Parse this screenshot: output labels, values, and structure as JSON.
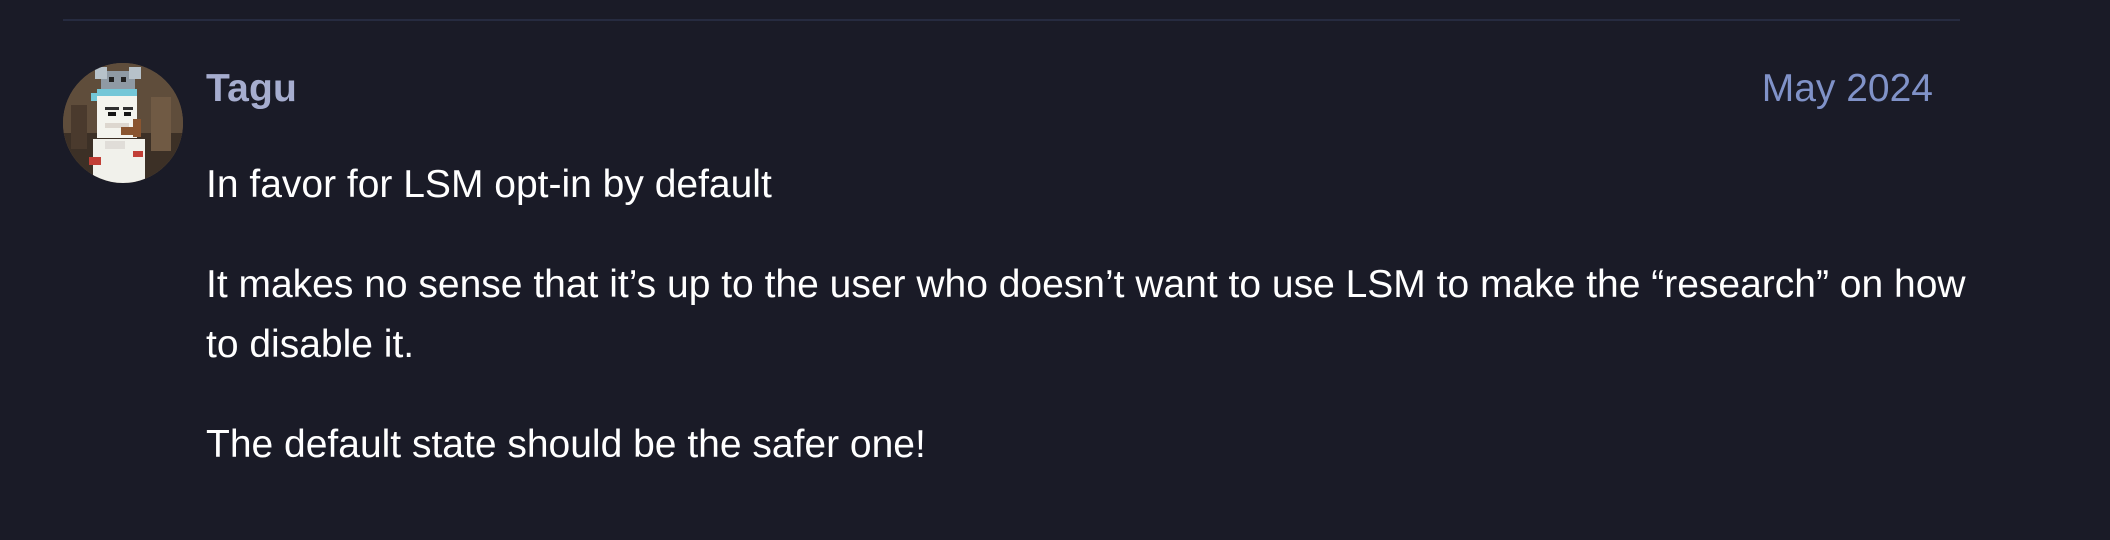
{
  "post": {
    "author": "Tagu",
    "date": "May 2024",
    "avatar_icon": "pixel-character-avatar-icon",
    "paragraphs": [
      "In favor for LSM opt-in by default",
      "It makes no sense that it’s up to the user who doesn’t want to use LSM to make the “research” on how to disable it.",
      "The default state should be the safer one!"
    ]
  },
  "colors": {
    "background": "#1a1b27",
    "divider": "#262b40",
    "author": "#a6adcf",
    "date": "#8092c8",
    "body_text": "#ffffff"
  }
}
